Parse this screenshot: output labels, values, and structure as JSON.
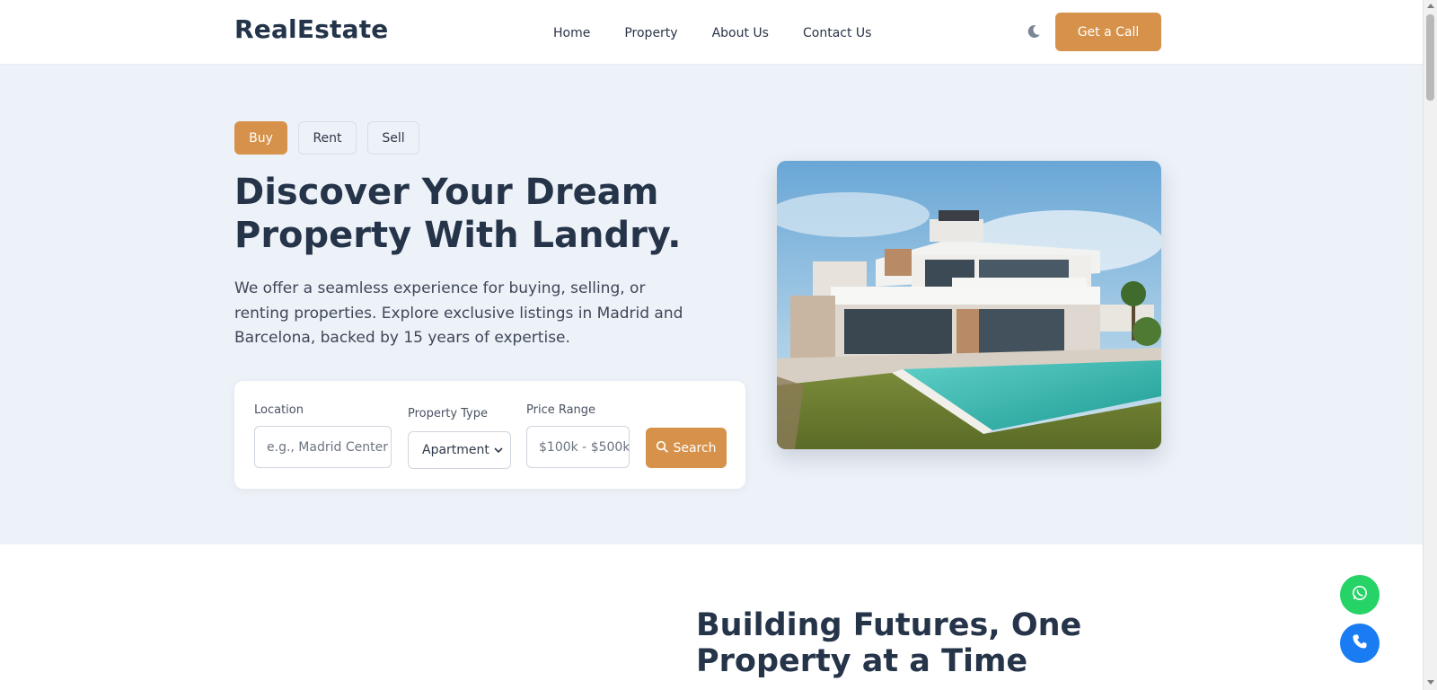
{
  "header": {
    "logo": "RealEstate",
    "nav": [
      "Home",
      "Property",
      "About Us",
      "Contact Us"
    ],
    "theme_icon": "moon-icon",
    "cta_label": "Get a Call"
  },
  "hero": {
    "tabs": [
      {
        "label": "Buy",
        "active": true
      },
      {
        "label": "Rent",
        "active": false
      },
      {
        "label": "Sell",
        "active": false
      }
    ],
    "headline": "Discover Your Dream Property With Landry.",
    "description": "We offer a seamless experience for buying, selling, or renting properties. Explore exclusive listings in Madrid and Barcelona, backed by 15 years of expertise.",
    "search": {
      "location_label": "Location",
      "location_placeholder": "e.g., Madrid Center",
      "type_label": "Property Type",
      "type_value": "Apartment",
      "price_label": "Price Range",
      "price_placeholder": "$100k - $500k",
      "button_label": "Search"
    }
  },
  "section2": {
    "title": "Building Futures, One Property at a Time"
  },
  "colors": {
    "accent": "#d6924a",
    "heading": "#253449",
    "hero_bg": "#edf1f8",
    "whatsapp": "#25d366",
    "phone": "#1a7cf2"
  }
}
